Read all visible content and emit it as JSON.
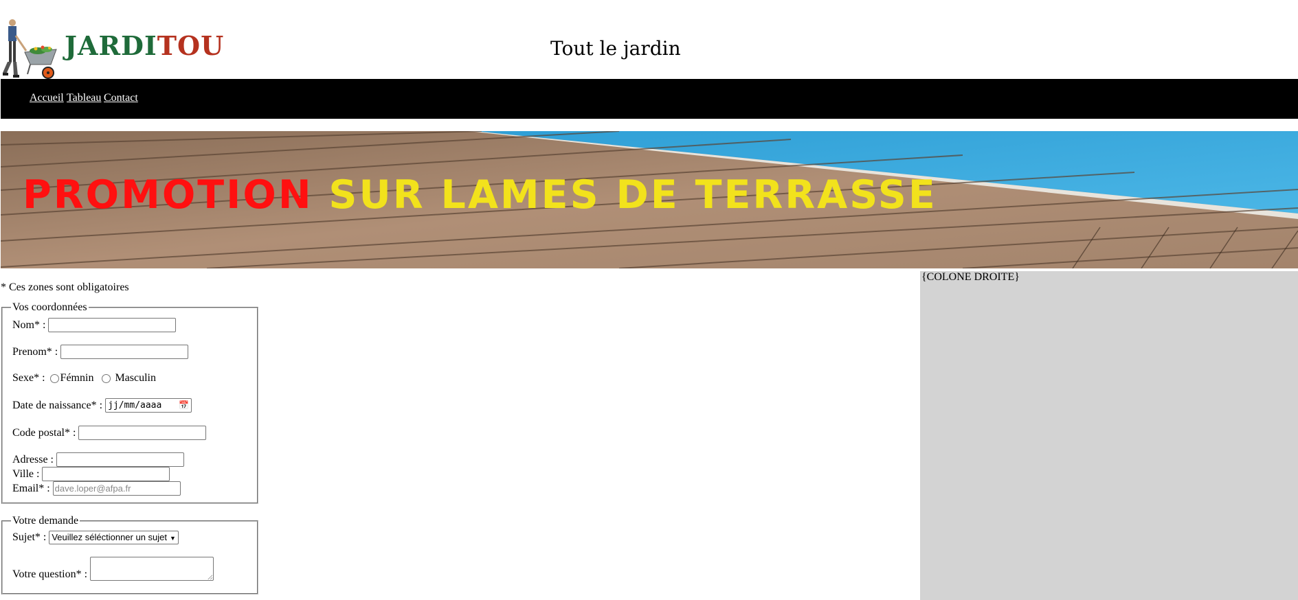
{
  "header": {
    "logo_part1": "JARDI",
    "logo_part2": "TOU",
    "site_title": "Tout le jardin"
  },
  "nav": {
    "items": [
      "Accueil",
      "Tableau",
      "Contact"
    ]
  },
  "banner": {
    "text_red": "PROMOTION",
    "text_yellow": "SUR LAMES DE TERRASSE"
  },
  "form": {
    "required_note": "* Ces zones sont obligatoires",
    "coords": {
      "legend": "Vos coordonnées",
      "nom_label": "Nom* :",
      "prenom_label": "Prenom* :",
      "sexe_label": "Sexe* :",
      "sexe_f": "Fémnin",
      "sexe_m": "Masculin",
      "dob_label": "Date de naissance* :",
      "dob_placeholder": "jj/mm/aaaa",
      "cp_label": "Code postal* :",
      "adresse_label": "Adresse :",
      "ville_label": "Ville :",
      "email_label": "Email* :",
      "email_placeholder": "dave.loper@afpa.fr"
    },
    "demande": {
      "legend": "Votre demande",
      "sujet_label": "Sujet* :",
      "sujet_selected": "Veuillez séléctionner un sujet",
      "question_label": "Votre question* :"
    }
  },
  "right_column": {
    "label": "{COLONE DROITE}"
  },
  "colors": {
    "logo_green": "#1f6b3a",
    "logo_red": "#b5321f",
    "nav_bg": "#000000",
    "right_col_bg": "#d3d3d3",
    "banner_red": "#ff1010",
    "banner_yellow": "#f2e21c"
  }
}
